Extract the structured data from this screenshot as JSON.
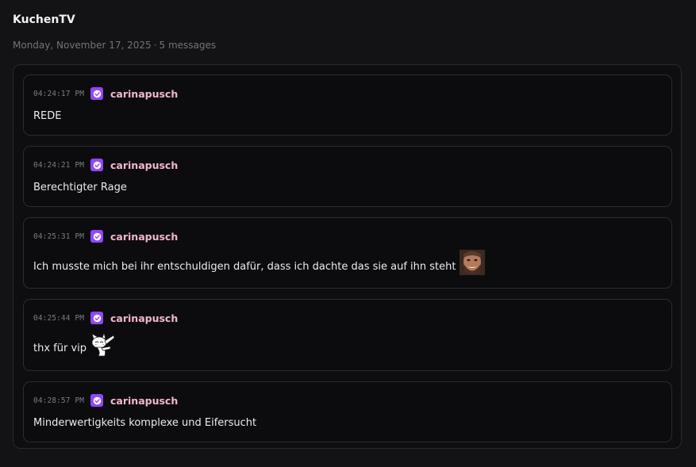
{
  "header": {
    "channel": "KuchenTV",
    "date": "Monday, November 17, 2025",
    "separator": "·",
    "count": "5 messages"
  },
  "colors": {
    "username": "#f4b6cf",
    "badge": "#9146ff",
    "background": "#131315",
    "card_border": "#2c2c31"
  },
  "messages": [
    {
      "time": "04:24:17 PM",
      "badge_icon": "verified-badge-icon",
      "user": "carinapusch",
      "text": "REDE"
    },
    {
      "time": "04:24:21 PM",
      "badge_icon": "verified-badge-icon",
      "user": "carinapusch",
      "text": "Berechtigter Rage"
    },
    {
      "time": "04:25:31 PM",
      "badge_icon": "verified-badge-icon",
      "user": "carinapusch",
      "text": "Ich musste mich bei ihr entschuldigen dafür, dass ich dachte das sie auf ihn steht",
      "emote": "bearded-face-emote"
    },
    {
      "time": "04:25:44 PM",
      "badge_icon": "verified-badge-icon",
      "user": "carinapusch",
      "text": "thx für vip",
      "emote": "white-cat-dab-emote"
    },
    {
      "time": "04:28:57 PM",
      "badge_icon": "verified-badge-icon",
      "user": "carinapusch",
      "text": "Minderwertigkeits komplexe und Eifersucht"
    }
  ]
}
